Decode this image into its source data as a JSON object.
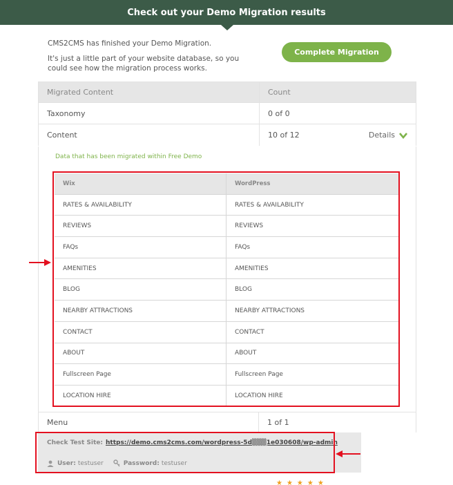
{
  "header": {
    "title": "Check out your Demo Migration results"
  },
  "intro": {
    "line1": "CMS2CMS has finished your Demo Migration.",
    "line2": "It's just a little part of your website database, so you could see how the migration process works."
  },
  "actions": {
    "complete_label": "Complete Migration"
  },
  "summary": {
    "headers": [
      "Migrated Content",
      "Count"
    ],
    "rows": [
      {
        "name": "Taxonomy",
        "count": "0 of 0"
      },
      {
        "name": "Content",
        "count": "10 of 12",
        "details": "Details"
      }
    ],
    "menu": {
      "name": "Menu",
      "count": "1 of 1"
    }
  },
  "migration": {
    "note": "Data that has been migrated within Free Demo",
    "headers": [
      "Wix",
      "WordPress"
    ],
    "rows": [
      [
        "RATES & AVAILABILITY",
        "RATES & AVAILABILITY"
      ],
      [
        "REVIEWS",
        "REVIEWS"
      ],
      [
        "FAQs",
        "FAQs"
      ],
      [
        "AMENITIES",
        "AMENITIES"
      ],
      [
        "BLOG",
        "BLOG"
      ],
      [
        "NEARBY ATTRACTIONS",
        "NEARBY ATTRACTIONS"
      ],
      [
        "CONTACT",
        "CONTACT"
      ],
      [
        "ABOUT",
        "ABOUT"
      ],
      [
        "Fullscreen Page",
        "Fullscreen Page"
      ],
      [
        "LOCATION HIRE",
        "LOCATION HIRE"
      ]
    ]
  },
  "test_site": {
    "label": "Check Test Site:",
    "url": "https://demo.cms2cms.com/wordpress-5d▒▒▒1e030608/wp-admin",
    "user_label": "User:",
    "user": "testuser",
    "password_label": "Password:",
    "password": "testuser"
  },
  "colors": {
    "header": "#3c5b48",
    "accent": "#7eb34a",
    "highlight": "#e3101f"
  }
}
